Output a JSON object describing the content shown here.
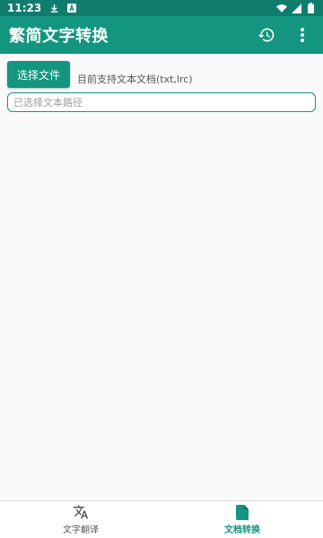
{
  "status_bar": {
    "time": "11:23",
    "icons": [
      "download-icon",
      "a-notification-icon",
      "wifi-icon",
      "signal-icon",
      "battery-icon"
    ]
  },
  "app_bar": {
    "title": "繁简文字转换",
    "actions": [
      "history-icon",
      "more-vert-icon"
    ]
  },
  "main": {
    "choose_button_label": "选择文件",
    "hint": "目前支持文本文档(txt,lrc)",
    "path_placeholder": "已选择文本路径"
  },
  "bottom_nav": {
    "items": [
      {
        "label": "文字翻译",
        "icon": "translate-icon",
        "active": false
      },
      {
        "label": "文档转换",
        "icon": "document-icon",
        "active": true
      }
    ]
  },
  "colors": {
    "primary": "#13957f",
    "status_bar": "#0f7c6e",
    "background": "#fafafa"
  }
}
